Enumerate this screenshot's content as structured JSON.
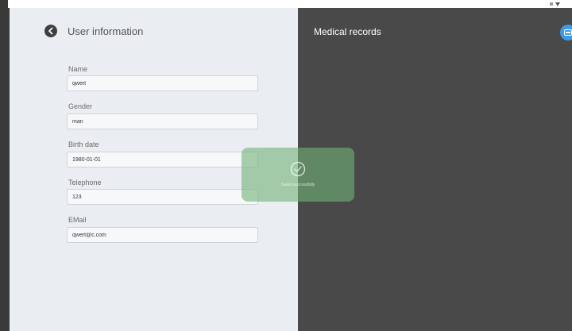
{
  "left_panel": {
    "title": "User information",
    "fields": [
      {
        "label": "Name",
        "value": "qwert"
      },
      {
        "label": "Gender",
        "value": "man"
      },
      {
        "label": "Birth date",
        "value": "1980-01-01"
      },
      {
        "label": "Telephone",
        "value": "123"
      },
      {
        "label": "EMail",
        "value": "qwert@c.com"
      }
    ]
  },
  "right_panel": {
    "title": "Medical records",
    "fab_icon": "calendar-icon"
  },
  "toast": {
    "icon": "check-circle-icon",
    "message": "Saved successfully"
  },
  "colors": {
    "left_bg": "#eaedf2",
    "right_bg": "#494949",
    "accent": "#3d9be9",
    "toast": "#72b276"
  }
}
